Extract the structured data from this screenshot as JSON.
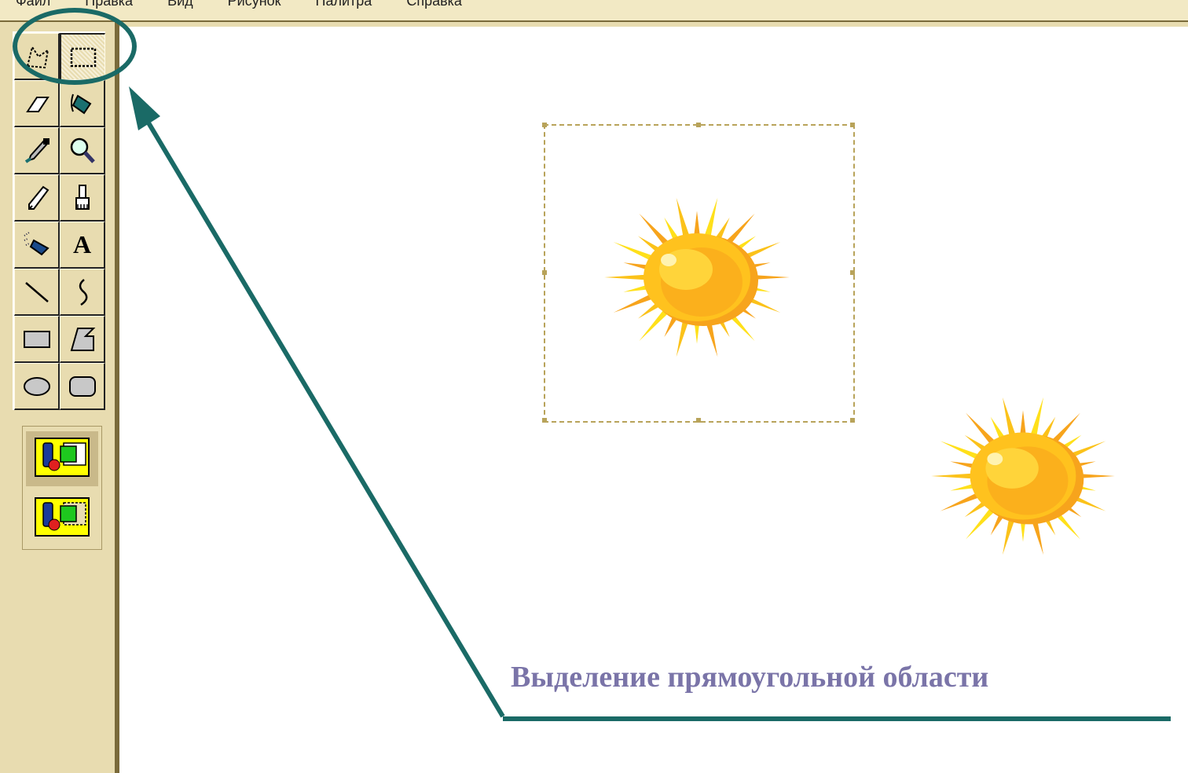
{
  "menubar": {
    "items": [
      "Файл",
      "Правка",
      "Вид",
      "Рисунок",
      "Палитра",
      "Справка"
    ]
  },
  "toolbox": {
    "tools": [
      {
        "name": "free-form-select-icon",
        "active": false
      },
      {
        "name": "rectangle-select-icon",
        "active": true
      },
      {
        "name": "eraser-icon",
        "active": false
      },
      {
        "name": "fill-bucket-icon",
        "active": false
      },
      {
        "name": "color-picker-icon",
        "active": false
      },
      {
        "name": "magnifier-icon",
        "active": false
      },
      {
        "name": "pencil-icon",
        "active": false
      },
      {
        "name": "brush-icon",
        "active": false
      },
      {
        "name": "airbrush-icon",
        "active": false
      },
      {
        "name": "text-icon",
        "active": false
      },
      {
        "name": "line-icon",
        "active": false
      },
      {
        "name": "curve-icon",
        "active": false
      },
      {
        "name": "rectangle-icon",
        "active": false
      },
      {
        "name": "polygon-icon",
        "active": false
      },
      {
        "name": "ellipse-icon",
        "active": false
      },
      {
        "name": "rounded-rectangle-icon",
        "active": false
      }
    ],
    "text_tool_glyph": "A",
    "options": [
      {
        "name": "opaque-selection-icon",
        "active": true
      },
      {
        "name": "transparent-selection-icon",
        "active": false
      }
    ]
  },
  "canvas": {
    "images": [
      "sun-icon",
      "sun-icon"
    ]
  },
  "annotation": {
    "caption": "Выделение прямоугольной области",
    "color": "#1a6a66",
    "caption_color": "#7a74a8"
  }
}
